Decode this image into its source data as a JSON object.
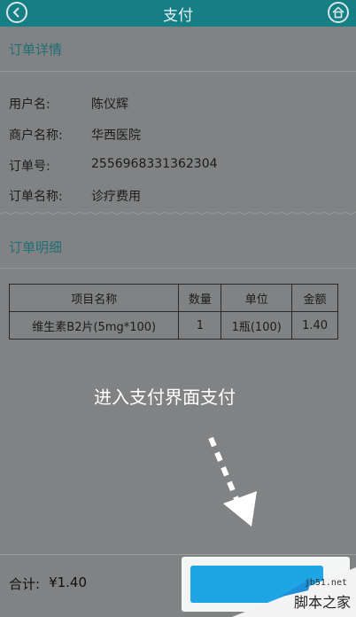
{
  "header": {
    "title": "支付"
  },
  "order_details": {
    "section_title": "订单详情",
    "rows": [
      {
        "label": "用户名:",
        "value": "陈仪辉"
      },
      {
        "label": "商户名称:",
        "value": "华西医院"
      },
      {
        "label": "订单号:",
        "value": "2556968331362304"
      },
      {
        "label": "订单名称:",
        "value": "诊疗费用"
      }
    ]
  },
  "order_items": {
    "section_title": "订单明细",
    "columns": [
      "项目名称",
      "数量",
      "单位",
      "金额"
    ],
    "rows": [
      [
        "维生素B2片(5mg*100)",
        "1",
        "1瓶(100)",
        "1.40"
      ]
    ]
  },
  "overlay": {
    "instruction": "进入支付界面支付"
  },
  "footer": {
    "total_label": "合计:",
    "total_value": "¥1.40"
  },
  "watermark": {
    "url": "jb51.net",
    "text": "脚本之家"
  },
  "colors": {
    "header_bg": "#167f86",
    "pay_button": "#1ea5e6",
    "section_title": "#1f6f76"
  }
}
